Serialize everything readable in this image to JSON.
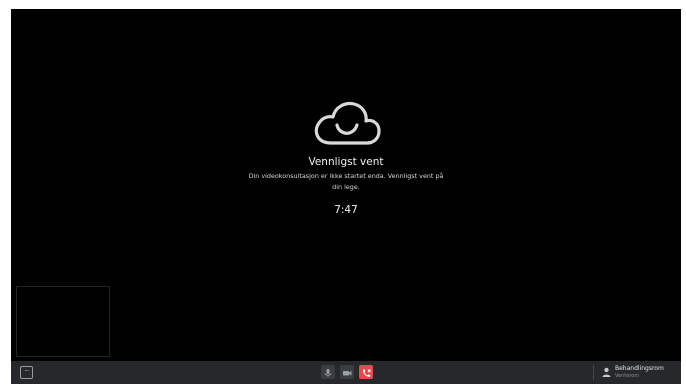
{
  "waiting": {
    "logo_icon": "cloud-smile-icon",
    "title": "Vennligst vent",
    "message": "Din videokonsultasjon er ikke startet enda. Vennligst vent på din lege.",
    "timer": "7:47"
  },
  "toolbar": {
    "more_label": "···",
    "more_icon": "ellipsis-icon",
    "mic_icon": "microphone-icon",
    "camera_icon": "camera-icon",
    "hangup_icon": "phone-hangup-icon",
    "user_icon": "user-icon",
    "room_name": "Behandlingsrom",
    "room_status": "Venterom"
  },
  "colors": {
    "background": "#000000",
    "toolbar": "#26282b",
    "hangup": "#e04b50",
    "text": "#ffffff"
  }
}
